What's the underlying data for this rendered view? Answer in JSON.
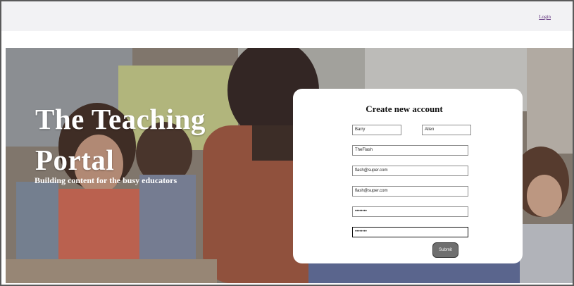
{
  "header": {
    "login_label": "Login"
  },
  "hero": {
    "title": "The Teaching Portal",
    "subtitle": "Building content for the busy educators"
  },
  "form": {
    "heading": "Create new account",
    "first_name_value": "Barry",
    "last_name_value": "Allen",
    "username_value": "TheFlash",
    "email_value": "flash@super.com",
    "email_confirm_value": "flash@super.com",
    "password_value": "••••••••",
    "password_confirm_value": "••••••••",
    "submit_label": "Submit"
  }
}
